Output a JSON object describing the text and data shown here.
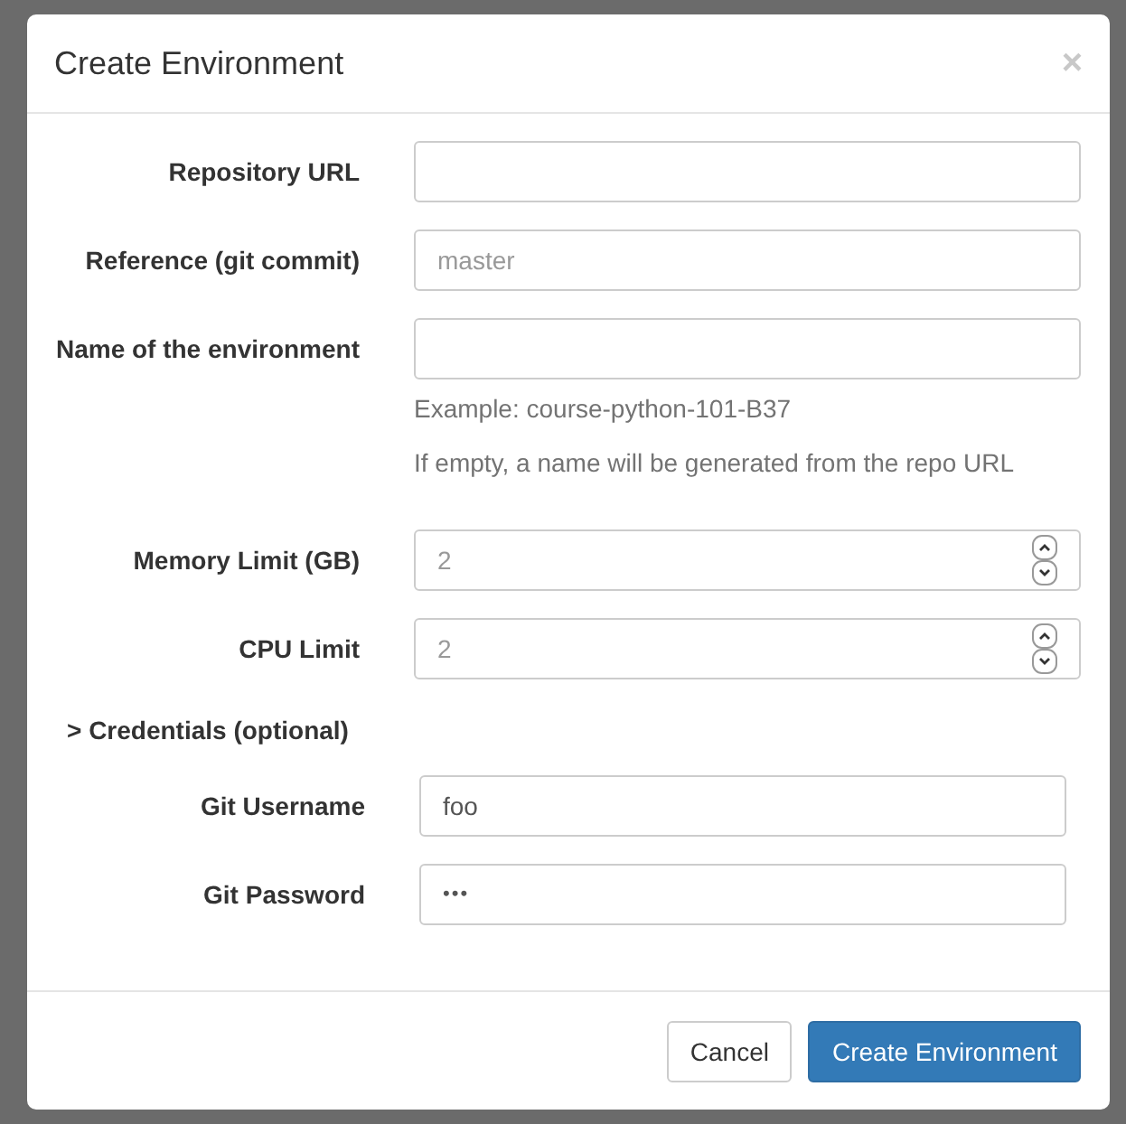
{
  "dialog": {
    "title": "Create Environment",
    "close": "×",
    "fields": [
      {
        "kind": "text",
        "label": "Repository URL"
      },
      {
        "kind": "text",
        "label": "Reference (git commit)",
        "placeholder": "master"
      },
      {
        "kind": "text",
        "label": "Name of the environment",
        "help": [
          "Example: course-python-101-B37",
          "If empty, a name will be generated from the repo URL"
        ]
      },
      {
        "kind": "number",
        "label": "Memory Limit (GB)",
        "placeholder": "2"
      },
      {
        "kind": "number",
        "label": "CPU Limit",
        "placeholder": "2"
      }
    ],
    "credentials": {
      "toggle": "> Credentials (optional)",
      "fields": [
        {
          "kind": "text",
          "label": "Git Username",
          "value": "foo"
        },
        {
          "kind": "password",
          "label": "Git Password",
          "value": "•••"
        }
      ]
    },
    "buttons": [
      {
        "kind": "default",
        "label": "Cancel"
      },
      {
        "kind": "primary",
        "label": "Create Environment"
      }
    ]
  }
}
